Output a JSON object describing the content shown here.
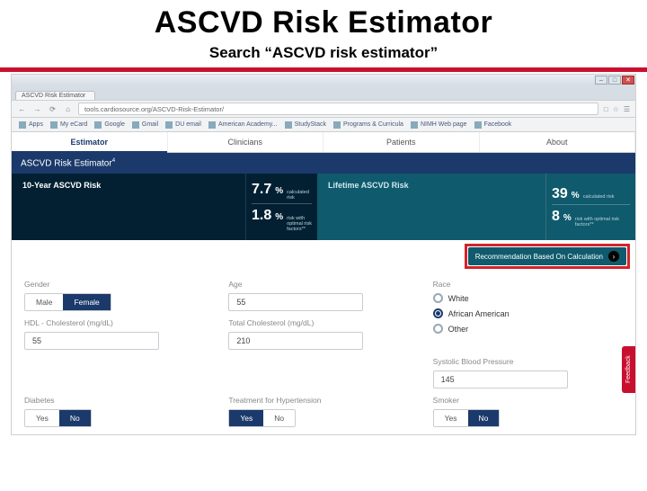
{
  "slide": {
    "title": "ASCVD Risk Estimator",
    "subtitle": "Search “ASCVD risk estimator”"
  },
  "browser": {
    "tab": "ASCVD Risk Estimator",
    "url": "tools.cardiosource.org/ASCVD-Risk-Estimator/",
    "win": {
      "min": "–",
      "max": "□",
      "close": "✕"
    },
    "bookmarks_label": "Apps",
    "bookmarks": [
      "My eCard",
      "Google",
      "Gmail",
      "DU email",
      "American Academy...",
      "StudyStack",
      "Programs & Curricula",
      "NIMH Web page",
      "Facebook"
    ]
  },
  "nav": {
    "tabs": [
      "Estimator",
      "Clinicians",
      "Patients",
      "About"
    ],
    "active": 0
  },
  "app": {
    "title": "ASCVD Risk Estimator",
    "sup": "4"
  },
  "risk": {
    "ten_year_label": "10-Year ASCVD Risk",
    "lifetime_label": "Lifetime ASCVD Risk",
    "calc_label": "calculated risk",
    "optimal_label": "risk with optimal risk factors**",
    "ten_calc": "7.7",
    "ten_opt": "1.8",
    "life_calc": "39",
    "life_opt": "8",
    "pct": "%",
    "reco": "Recommendation Based On Calculation"
  },
  "form": {
    "gender": {
      "label": "Gender",
      "male": "Male",
      "female": "Female"
    },
    "age": {
      "label": "Age",
      "value": "55"
    },
    "race": {
      "label": "Race",
      "options": [
        "White",
        "African American",
        "Other"
      ],
      "selected": 1
    },
    "hdl": {
      "label": "HDL - Cholesterol (mg/dL)",
      "value": "55"
    },
    "tc": {
      "label": "Total Cholesterol (mg/dL)",
      "value": "210"
    },
    "sbp": {
      "label": "Systolic Blood Pressure",
      "value": "145"
    },
    "diabetes": {
      "label": "Diabetes",
      "yes": "Yes",
      "no": "No"
    },
    "htn": {
      "label": "Treatment for Hypertension",
      "yes": "Yes",
      "no": "No"
    },
    "smoker": {
      "label": "Smoker",
      "yes": "Yes",
      "no": "No"
    }
  },
  "feedback": "Feedback"
}
